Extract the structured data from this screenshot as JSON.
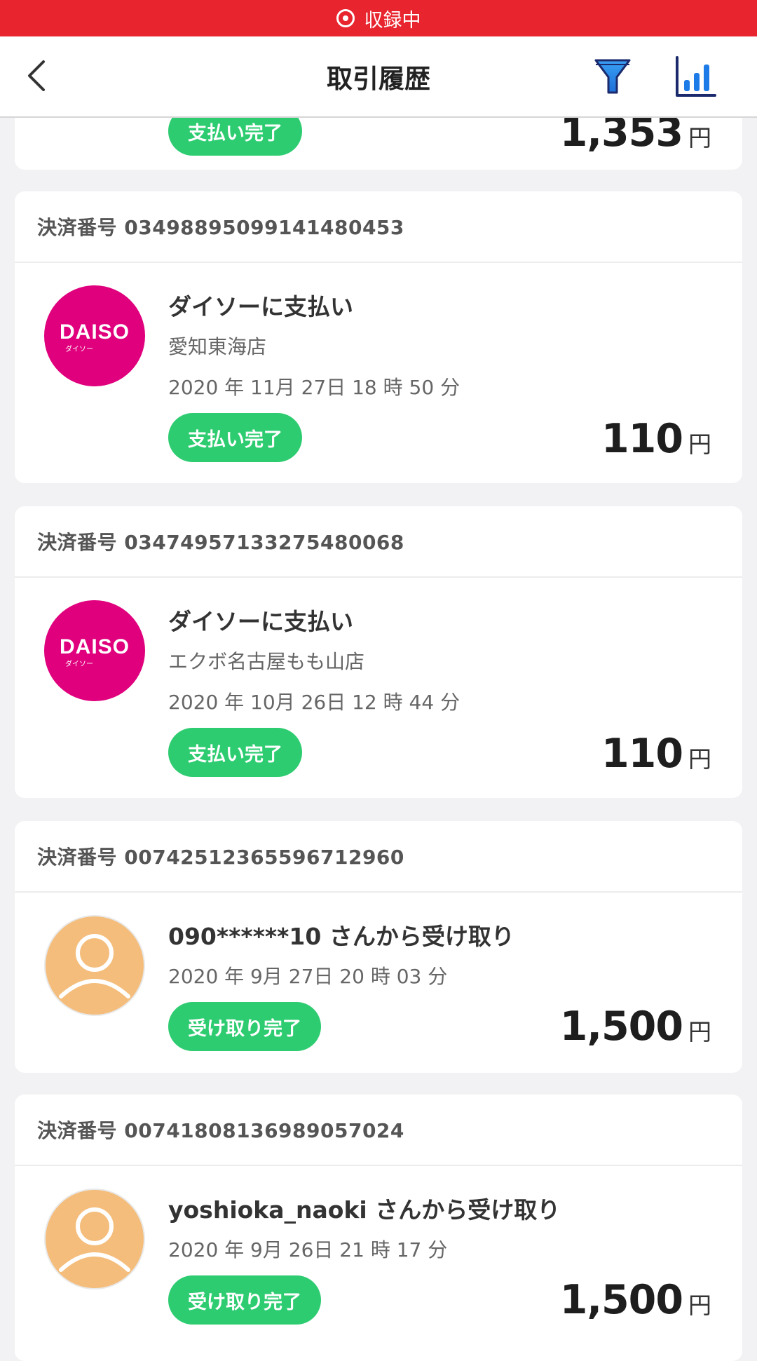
{
  "status_bar": {
    "recording_label": "収録中"
  },
  "nav": {
    "title": "取引履歴",
    "back_icon": "chevron-left-icon",
    "filter_icon": "filter-icon",
    "stats_icon": "bar-chart-icon"
  },
  "colors": {
    "recording_red": "#e8242e",
    "success_green": "#2ecc71",
    "daiso_pink": "#e0007d",
    "user_avatar": "#f4bd7b",
    "icon_blue": "#1d6fd8"
  },
  "partial_top": {
    "badge": "支払い完了",
    "amount": "1,353",
    "unit": "円"
  },
  "transactions": [
    {
      "number_label": "決済番号 0349889509914148045​3",
      "title": "ダイソーに支払い",
      "store": "愛知東海店",
      "datetime": "2020 年 11月 27日  18 時 50 分",
      "status": "支払い完了",
      "amount": "110",
      "unit": "円",
      "avatar": "daiso-logo",
      "logo_text": "DAISO",
      "logo_sub": "ダイソー"
    },
    {
      "number_label": "決済番号 03474957133275480068",
      "title": "ダイソーに支払い",
      "store": "エクボ名古屋もも山店",
      "datetime": "2020 年 10月 26日  12 時 44 分",
      "status": "支払い完了",
      "amount": "110",
      "unit": "円",
      "avatar": "daiso-logo",
      "logo_text": "DAISO",
      "logo_sub": "ダイソー"
    },
    {
      "number_label": "決済番号 00742512365596712960",
      "title": "090******10 さんから受け取り",
      "datetime": "2020 年 9月 27日  20 時 03 分",
      "status": "受け取り完了",
      "amount": "1,500",
      "unit": "円",
      "avatar": "user-icon"
    },
    {
      "number_label": "決済番号 00741808136989057024",
      "title": "yoshioka_naoki さんから受け取り",
      "datetime": "2020 年 9月 26日  21 時 17 分",
      "status": "受け取り完了",
      "amount": "1,500",
      "unit": "円",
      "avatar": "user-icon"
    }
  ]
}
